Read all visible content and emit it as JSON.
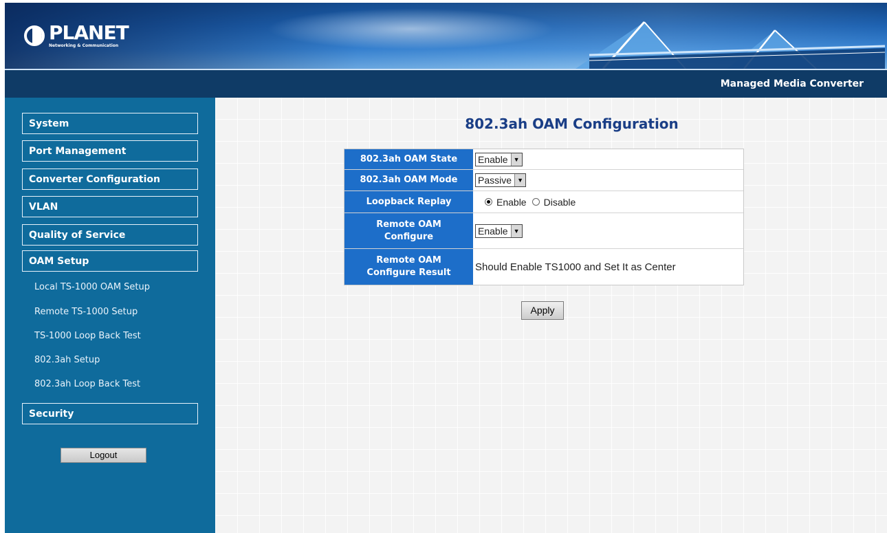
{
  "banner": {
    "logo_text": "PLANET",
    "logo_subtext": "Networking & Communication",
    "product_title": "Managed Media Converter"
  },
  "sidebar": {
    "menu": [
      {
        "label": "System"
      },
      {
        "label": "Port Management"
      },
      {
        "label": "Converter Configuration"
      },
      {
        "label": "VLAN"
      },
      {
        "label": "Quality of Service"
      },
      {
        "label": "OAM Setup"
      }
    ],
    "submenu": [
      {
        "label": "Local TS-1000 OAM Setup"
      },
      {
        "label": "Remote TS-1000 Setup"
      },
      {
        "label": "TS-1000 Loop Back Test"
      },
      {
        "label": "802.3ah Setup"
      },
      {
        "label": "802.3ah Loop Back Test"
      }
    ],
    "security_label": "Security",
    "logout_label": "Logout"
  },
  "main": {
    "title": "802.3ah OAM Configuration",
    "rows": {
      "oam_state": {
        "label": "802.3ah OAM State",
        "value": "Enable"
      },
      "oam_mode": {
        "label": "802.3ah OAM Mode",
        "value": "Passive"
      },
      "loopback_replay": {
        "label": "Loopback Replay",
        "options": [
          "Enable",
          "Disable"
        ],
        "selected": "Enable"
      },
      "remote_oam_configure": {
        "label_line1": "Remote OAM",
        "label_line2": "Configure",
        "value": "Enable"
      },
      "remote_oam_result": {
        "label_line1": "Remote OAM",
        "label_line2": "Configure Result",
        "value": "Should Enable TS1000 and Set It as Center"
      }
    },
    "apply_label": "Apply"
  },
  "colors": {
    "sidebar_bg": "#0f6b9c",
    "header_strip": "#0f3b66",
    "label_bg": "#1d6ec9",
    "title_color": "#1a3e86"
  }
}
